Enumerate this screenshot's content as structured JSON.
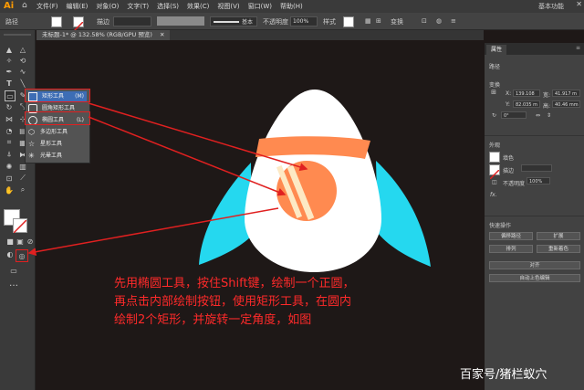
{
  "menubar": {
    "logo": "Ai",
    "menus": [
      "文件(F)",
      "编辑(E)",
      "对象(O)",
      "文字(T)",
      "选择(S)",
      "效果(C)",
      "视图(V)",
      "窗口(W)",
      "帮助(H)"
    ],
    "workspace": "基本功能"
  },
  "controlbar": {
    "path_label": "路径",
    "stroke_label": "描边",
    "brush_label": "基本",
    "opacity_label": "不透明度",
    "opacity_value": "100%",
    "style_label": "样式",
    "transform_label": "变换"
  },
  "document": {
    "tab_title": "未标题-1* @ 132.58% (RGB/GPU 预览)"
  },
  "flyout": {
    "items": [
      {
        "label": "矩形工具",
        "shortcut": "(M)"
      },
      {
        "label": "圆角矩形工具",
        "shortcut": ""
      },
      {
        "label": "椭圆工具",
        "shortcut": "(L)"
      },
      {
        "label": "多边形工具",
        "shortcut": ""
      },
      {
        "label": "星形工具",
        "shortcut": ""
      },
      {
        "label": "光晕工具",
        "shortcut": ""
      }
    ]
  },
  "panel": {
    "tab": "属性",
    "section_shape": "路径",
    "section_transform": "变换",
    "x_label": "X:",
    "x_value": "139.108",
    "y_label": "Y:",
    "y_value": "82.035 m",
    "w_label": "宽:",
    "w_value": "41.917 m",
    "h_label": "高:",
    "h_value": "40.46 mm",
    "angle_value": "0°",
    "section_appearance": "外观",
    "fill_label": "填色",
    "stroke_label": "描边",
    "opacity_label": "不透明度",
    "opacity_value": "100%",
    "fx_label": "fx.",
    "section_quick": "快速操作",
    "buttons": [
      "偏移路径",
      "扩展",
      "排列",
      "重新着色",
      "对齐",
      "自动上色编辑"
    ]
  },
  "annotation": {
    "line1": "先用椭圆工具，按住Shift键，绘制一个正圆，",
    "line2": "再点击内部绘制按钮，使用矩形工具，在圆内",
    "line3": "绘制2个矩形，并旋转一定角度，如图"
  },
  "watermark": "百家号/猪栏蚁穴",
  "colors": {
    "canvas": "#1e1817",
    "rocket_body": "#ffffff",
    "rocket_band": "#ff8a50",
    "rocket_wing": "#25d8ef",
    "stripes": "#fde9c4",
    "annotation": "#ff2a2a"
  }
}
